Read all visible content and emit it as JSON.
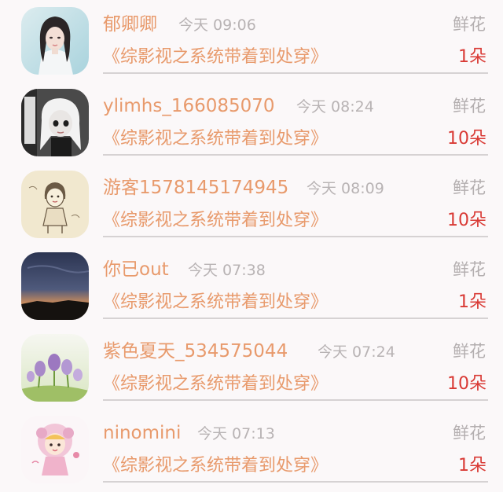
{
  "gift_list": {
    "items": [
      {
        "username": "郁卿卿",
        "time": "今天 09:06",
        "gift": "鲜花",
        "work_title": "《综影视之系统带着到处穿》",
        "count": "1朵",
        "avatar": "avatar-woman-portrait"
      },
      {
        "username": "ylimhs_166085070",
        "time": "今天 08:24",
        "gift": "鲜花",
        "work_title": "《综影视之系统带着到处穿》",
        "count": "10朵",
        "avatar": "avatar-doll"
      },
      {
        "username": "游客1578145174945",
        "time": "今天 08:09",
        "gift": "鲜花",
        "work_title": "《综影视之系统带着到处穿》",
        "count": "10朵",
        "avatar": "avatar-sketch-girl"
      },
      {
        "username": "你已out",
        "time": "今天 07:38",
        "gift": "鲜花",
        "work_title": "《综影视之系统带着到处穿》",
        "count": "1朵",
        "avatar": "avatar-dusk-sky"
      },
      {
        "username": "紫色夏天_534575044",
        "time": "今天 07:24",
        "gift": "鲜花",
        "work_title": "《综影视之系统带着到处穿》",
        "count": "10朵",
        "avatar": "avatar-crocus-flowers"
      },
      {
        "username": "ninomini",
        "time": "今天 07:13",
        "gift": "鲜花",
        "work_title": "《综影视之系统带着到处穿》",
        "count": "1朵",
        "avatar": "avatar-cartoon-girl"
      }
    ]
  }
}
